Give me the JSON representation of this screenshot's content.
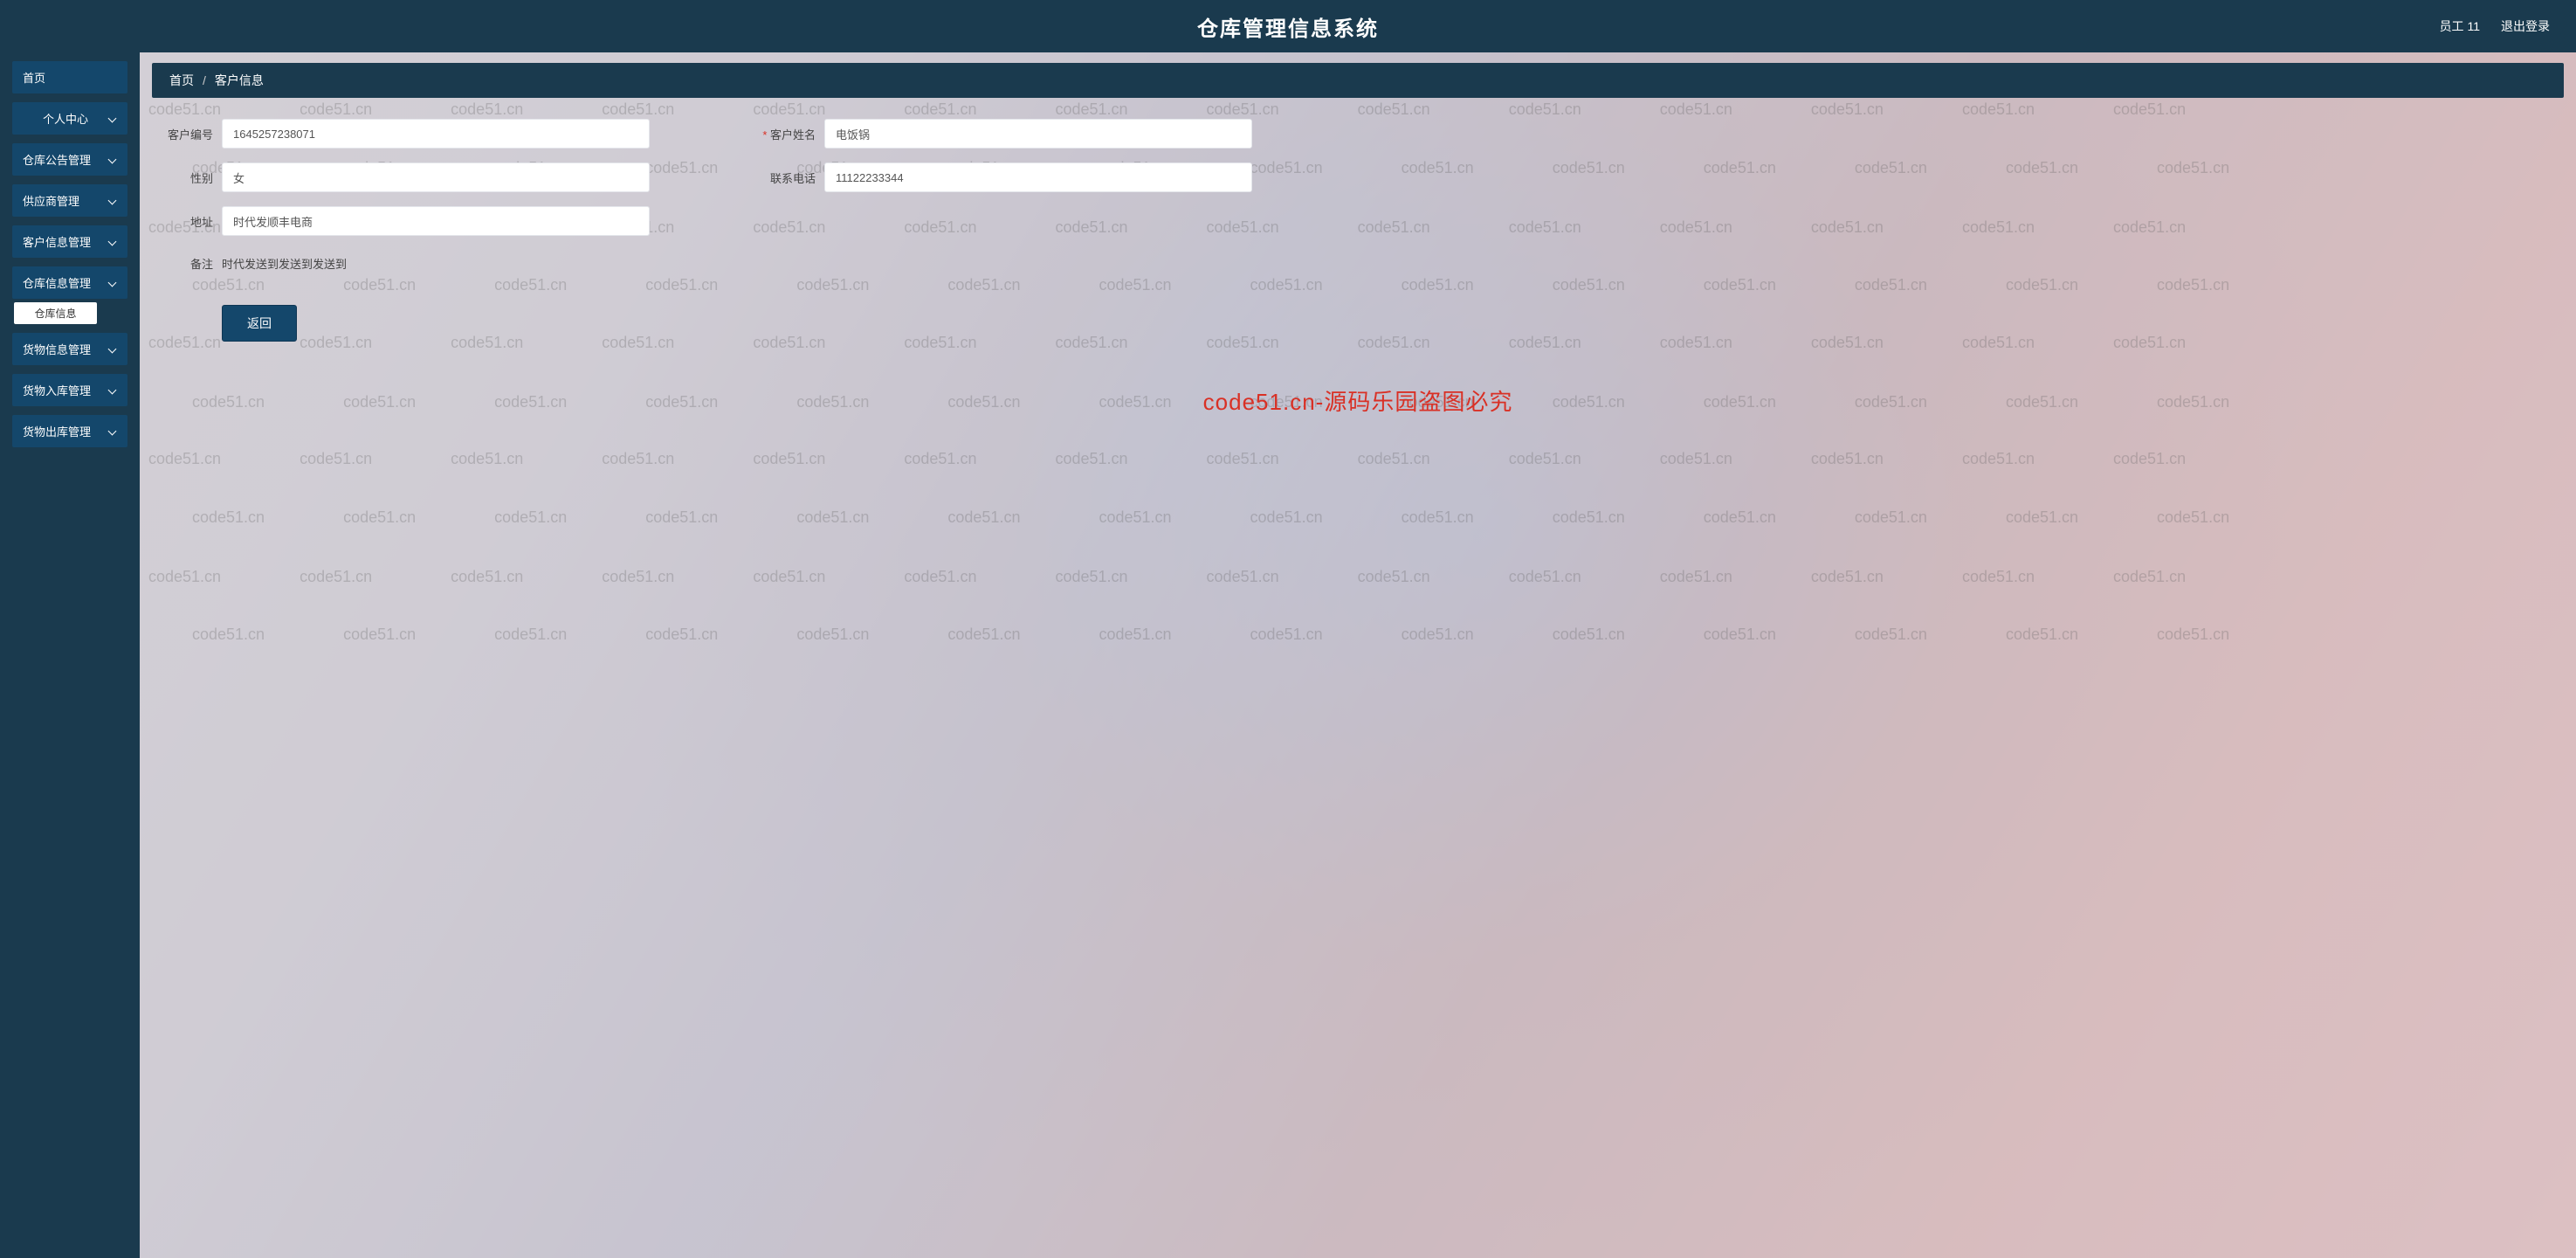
{
  "header": {
    "title": "仓库管理信息系统",
    "user_label": "员工 11",
    "logout_label": "退出登录"
  },
  "sidebar": {
    "items": [
      {
        "label": "首页",
        "expandable": false
      },
      {
        "label": "个人中心",
        "expandable": true
      },
      {
        "label": "仓库公告管理",
        "expandable": true
      },
      {
        "label": "供应商管理",
        "expandable": true
      },
      {
        "label": "客户信息管理",
        "expandable": true
      },
      {
        "label": "仓库信息管理",
        "expandable": true,
        "sub": "仓库信息"
      },
      {
        "label": "货物信息管理",
        "expandable": true
      },
      {
        "label": "货物入库管理",
        "expandable": true
      },
      {
        "label": "货物出库管理",
        "expandable": true
      }
    ]
  },
  "breadcrumb": {
    "home": "首页",
    "current": "客户信息"
  },
  "form": {
    "fields": {
      "customer_id": {
        "label": "客户编号",
        "value": "1645257238071"
      },
      "customer_name": {
        "label": "客户姓名",
        "value": "电饭锅",
        "required": true
      },
      "gender": {
        "label": "性别",
        "value": "女"
      },
      "phone": {
        "label": "联系电话",
        "value": "11122233344"
      },
      "address": {
        "label": "地址",
        "value": "时代发顺丰电商"
      },
      "remark": {
        "label": "备注",
        "value": "时代发送到发送到发送到"
      }
    },
    "back_button": "返回"
  },
  "watermark": {
    "text": "code51.cn",
    "center_text": "code51.cn-源码乐园盗图必究"
  }
}
